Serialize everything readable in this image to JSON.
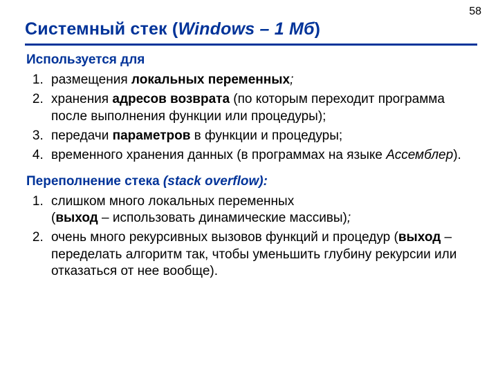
{
  "page_number": "58",
  "title_plain": "Системный стек (",
  "title_ital": "Windows – 1 Мб",
  "title_close": ")",
  "section1": {
    "header": "Используется для",
    "items": [
      {
        "pre": "размещения ",
        "bold": "локальных переменных",
        "post_ital": ";"
      },
      {
        "pre": "хранения ",
        "bold": "адресов возврата",
        "post": " (по которым переходит программа после выполнения функции или процедуры);"
      },
      {
        "pre": "передачи ",
        "bold": "параметров",
        "post": " в функции и процедуры;"
      },
      {
        "pre": "временного хранения данных (в программах на языке ",
        "ital": "Ассемблер",
        "post": ")."
      }
    ]
  },
  "section2": {
    "header_plain": "Переполнение стека ",
    "header_ital": "(stack overflow):",
    "items": [
      {
        "line1_pre": "слишком много локальных переменных",
        "line2_pre": "(",
        "line2_bold": "выход",
        "line2_post": " – использовать динамические массивы)",
        "line2_ital_tail": ";"
      },
      {
        "line1_pre": "очень много рекурсивных вызовов функций и процедур (",
        "line1_bold": "выход",
        "line1_post": " – переделать алгоритм так, чтобы уменьшить глубину рекурсии или отказаться от нее вообще)."
      }
    ]
  }
}
